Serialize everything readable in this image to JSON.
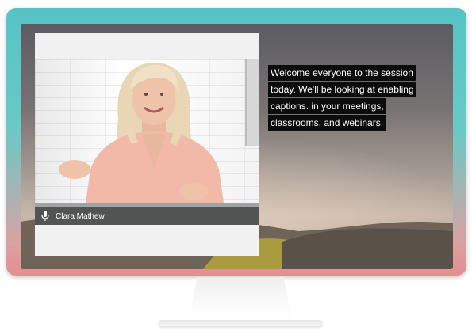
{
  "participant": {
    "name": "Clara Mathew",
    "icon": "microphone-icon"
  },
  "captions": {
    "lines": [
      "Welcome everyone to the session",
      "today. We'll be looking at enabling",
      "captions. in your meetings,",
      "classrooms, and webinars."
    ]
  },
  "colors": {
    "bezel_top": "#57c3c6",
    "bezel_bottom": "#e48f91",
    "caption_bg": "#0c0c0c",
    "caption_text": "#ffffff"
  }
}
